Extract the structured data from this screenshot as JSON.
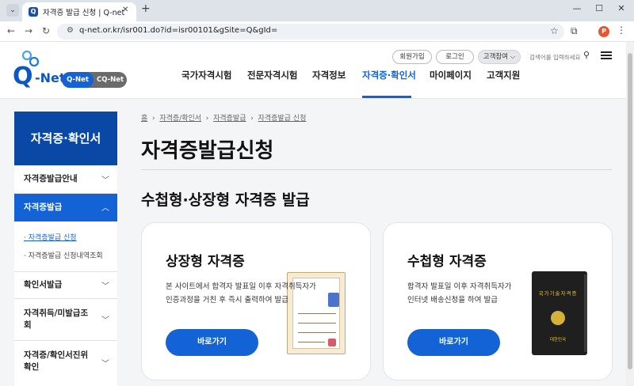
{
  "browser": {
    "tab_title": "자격증 발급 신청 | Q-net",
    "url": "q-net.or.kr/isr001.do?id=isr00101&gSite=Q&gId=",
    "profile_initial": "P"
  },
  "header": {
    "logo_q": "Q",
    "logo_net": "-Net",
    "pill_qnet": "Q-Net",
    "pill_cqnet": "CQ-Net",
    "join": "회원가입",
    "login": "로그인",
    "participate": "고객참여 ⌵",
    "search_placeholder": "검색어를 입력하세요",
    "nav": [
      "국가자격시험",
      "전문자격시험",
      "자격정보",
      "자격증·확인서",
      "마이페이지",
      "고객지원"
    ]
  },
  "sidebar": {
    "title": "자격증·확인서",
    "items": [
      {
        "label": "자격증발급안내"
      },
      {
        "label": "자격증발급"
      },
      {
        "label": "확인서발급"
      },
      {
        "label": "자격취득/미발급조회"
      },
      {
        "label": "자격증/확인서진위확인"
      }
    ],
    "sub_items": [
      "자격증발급 신청",
      "자격증발급 신청내역조회"
    ]
  },
  "main": {
    "breadcrumb": [
      "홈",
      "자격증/확인서",
      "자격증발급",
      "자격증발급 신청"
    ],
    "title": "자격증발급신청",
    "section_title": "수첩형·상장형 자격증 발급",
    "cards": [
      {
        "title": "상장형 자격증",
        "desc_line1": "본 사이트에서 합격자 발표일 이후 자격취득자가",
        "desc_line2": "인증과정을 거친 후 즉시 출력하여 발급",
        "button": "바로가기"
      },
      {
        "title": "수첩형 자격증",
        "desc_line1": "합격자 발표일 이후 자격취득자가",
        "desc_line2": "인터넷 배송신청을 하여 발급",
        "button": "바로가기",
        "book_title": "국가기술자격증",
        "book_bottom": "대한민국"
      }
    ]
  },
  "colors": {
    "brand_blue": "#1463d6",
    "sidebar_head": "#0a48a6",
    "page_bg": "#f4f5f7"
  }
}
